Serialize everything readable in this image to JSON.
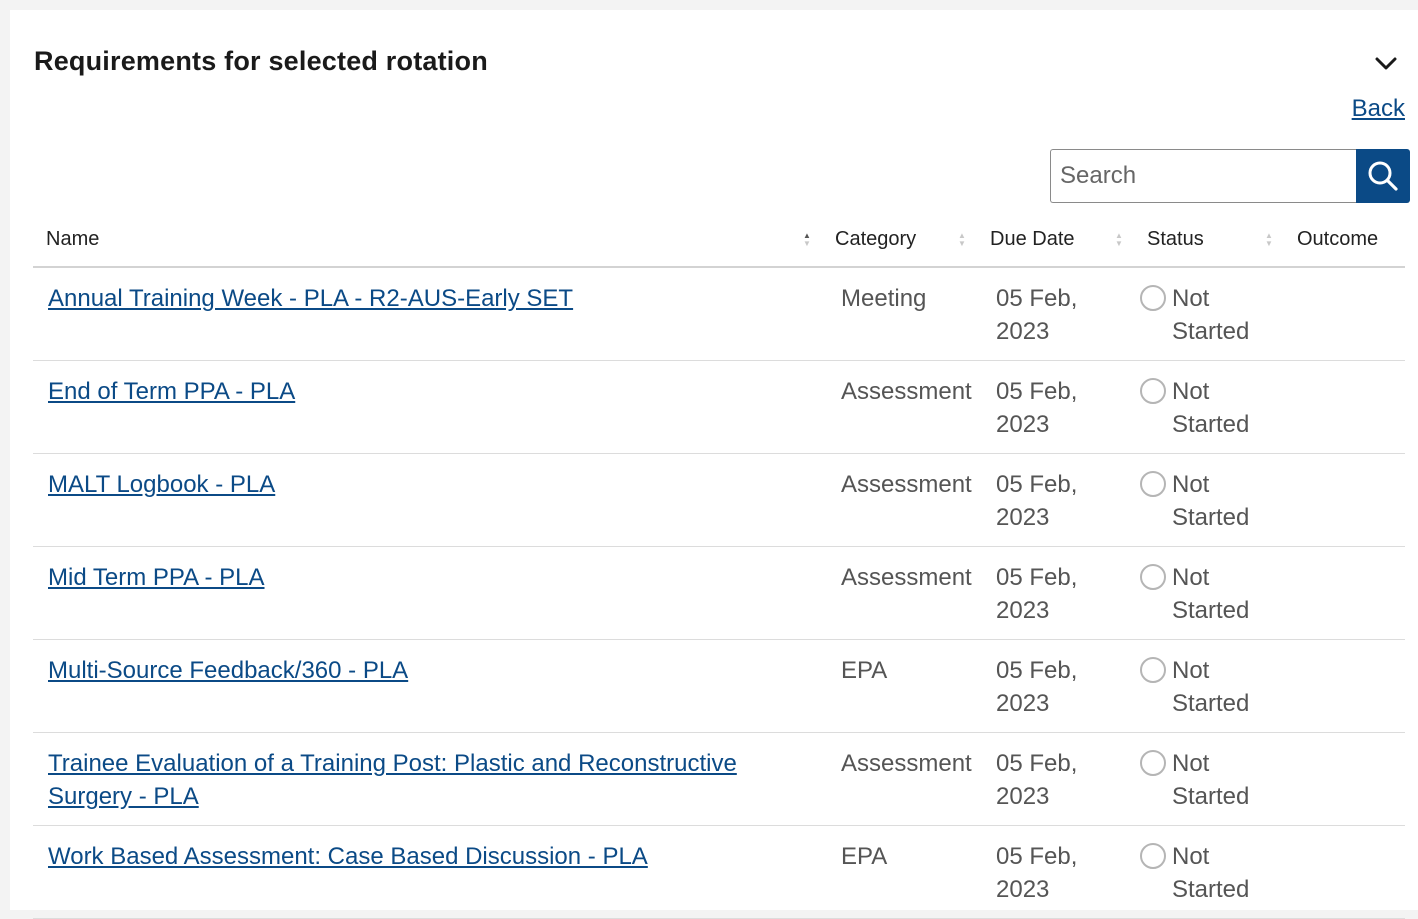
{
  "panel": {
    "title": "Requirements for selected rotation",
    "collapse_icon": "chevron-down-icon",
    "back_label": "Back"
  },
  "search": {
    "placeholder": "Search",
    "value": "",
    "icon": "search-icon"
  },
  "table": {
    "columns": {
      "name": "Name",
      "category": "Category",
      "due_date": "Due Date",
      "status": "Status",
      "outcome": "Outcome"
    },
    "sorted_column": "name",
    "rows": [
      {
        "name": "Annual Training Week - PLA - R2-AUS-Early SET",
        "category": "Meeting",
        "due_date": "05 Feb, 2023",
        "status": "Not Started",
        "outcome": ""
      },
      {
        "name": "End of Term PPA - PLA",
        "category": "Assessment",
        "due_date": "05 Feb, 2023",
        "status": "Not Started",
        "outcome": ""
      },
      {
        "name": "MALT Logbook - PLA",
        "category": "Assessment",
        "due_date": "05 Feb, 2023",
        "status": "Not Started",
        "outcome": ""
      },
      {
        "name": "Mid Term PPA - PLA",
        "category": "Assessment",
        "due_date": "05 Feb, 2023",
        "status": "Not Started",
        "outcome": ""
      },
      {
        "name": "Multi-Source Feedback/360 - PLA",
        "category": "EPA",
        "due_date": "05 Feb, 2023",
        "status": "Not Started",
        "outcome": ""
      },
      {
        "name": "Trainee Evaluation of a Training Post: Plastic and Reconstructive Surgery - PLA",
        "category": "Assessment",
        "due_date": "05 Feb, 2023",
        "status": "Not Started",
        "outcome": ""
      },
      {
        "name": "Work Based Assessment: Case Based Discussion - PLA",
        "category": "EPA",
        "due_date": "05 Feb, 2023",
        "status": "Not Started",
        "outcome": ""
      }
    ]
  },
  "colors": {
    "link": "#0b4a86",
    "search_button": "#0b4a86",
    "status_circle": "#b5b5b5",
    "row_divider": "#dcdcdc"
  }
}
